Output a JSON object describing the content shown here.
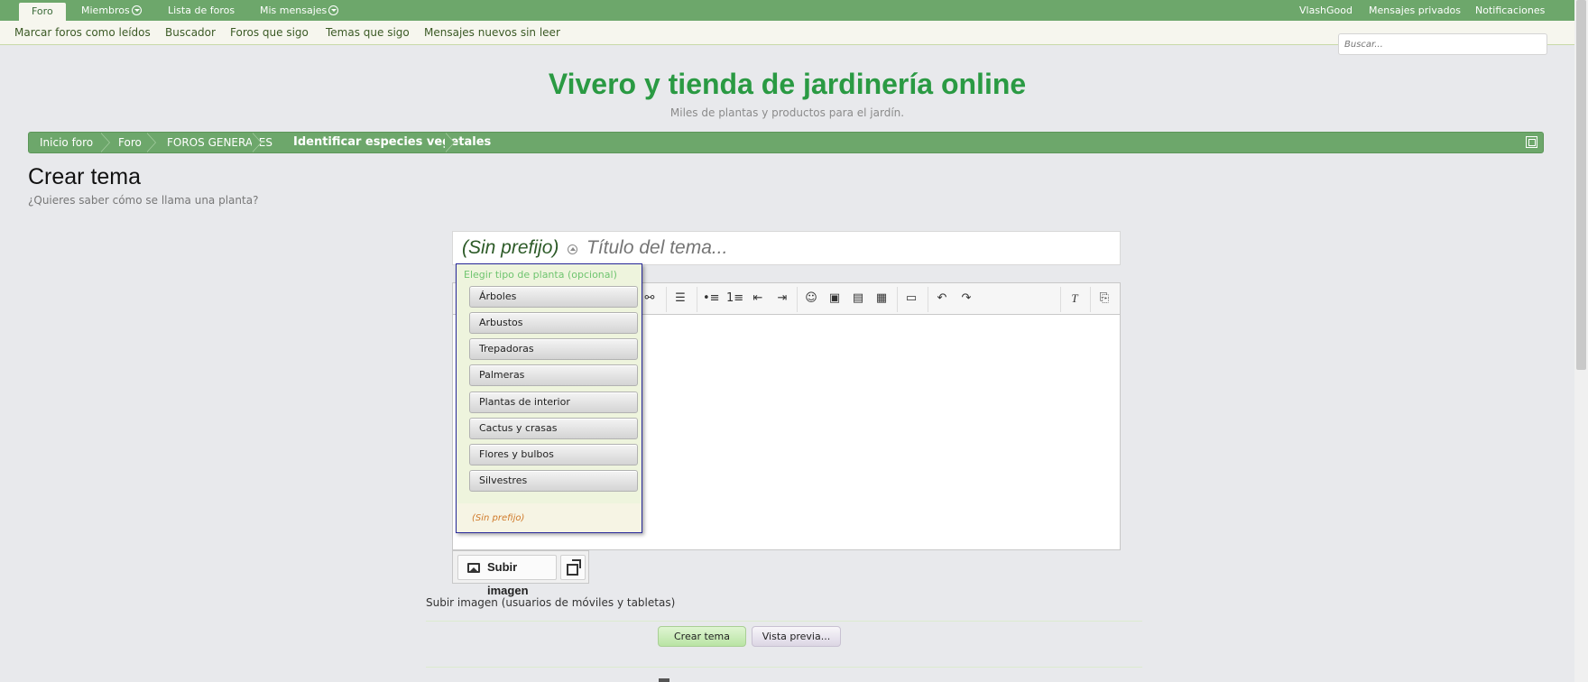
{
  "topnav": {
    "tabs": [
      {
        "label": "Foro",
        "active": true
      },
      {
        "label": "Miembros",
        "has_menu": true
      },
      {
        "label": "Lista de foros"
      },
      {
        "label": "Mis mensajes",
        "has_menu": true
      }
    ],
    "right": [
      "VlashGood",
      "Mensajes privados",
      "Notificaciones"
    ]
  },
  "subnav": {
    "links": [
      "Marcar foros como leídos",
      "Buscador",
      "Foros que sigo",
      "Temas que sigo",
      "Mensajes nuevos sin leer"
    ]
  },
  "search": {
    "placeholder": "Buscar..."
  },
  "site": {
    "title": "Vivero y tienda de jardinería online",
    "subtitle": "Miles de plantas y productos para el jardín."
  },
  "breadcrumb": [
    "Inicio foro",
    "Foro",
    "FOROS GENERALES",
    "Identificar especies vegetales"
  ],
  "page": {
    "title": "Crear tema",
    "description": "¿Quieres saber cómo se llama una planta?"
  },
  "form": {
    "prefix": "(Sin prefijo)",
    "title_placeholder": "Título del tema...",
    "upload_image_label": "Subir imagen",
    "mobile_upload_label": "Subir imagen (usuarios de móviles y tabletas)",
    "create_label": "Crear tema",
    "preview_label": "Vista previa..."
  },
  "prefix_menu": {
    "heading": "Elegir tipo de planta (opcional)",
    "items": [
      "Árboles",
      "Arbustos",
      "Trepadoras",
      "Palmeras",
      "Plantas de interior",
      "Cactus y crasas",
      "Flores y bulbos",
      "Silvestres"
    ],
    "no_prefix": "(Sin prefijo)"
  },
  "colors": {
    "nav_green": "#6da76b",
    "title_green": "#2a9a43",
    "page_bg": "#e8e9ec"
  },
  "icons": [
    "chevron-down-icon",
    "popout-icon",
    "image-icon",
    "expand-icon",
    "clear-format-icon",
    "undo-icon",
    "redo-icon",
    "smiley-icon"
  ]
}
